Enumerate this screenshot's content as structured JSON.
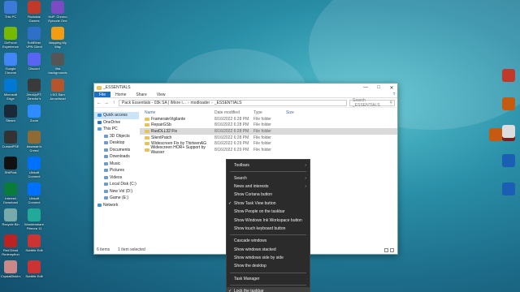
{
  "desktop": {
    "left_icons": [
      [
        "This PC",
        "Rockstar Games Launcher",
        "HoP: Chrono Episode One"
      ],
      [
        "GeForce Experience",
        "SoftEther VPN Client Manager",
        "Mapping My Way Remastered"
      ],
      [
        "Google Chrome",
        "Discord",
        "Vita backgrounds"
      ],
      [
        "Microsoft Edge",
        "ZeroUpPT: Director's Cut",
        "LSG Sam Arrowhead"
      ],
      [
        "Steam",
        "Zoom",
        ""
      ],
      [
        "CursedPSE",
        "Assassin's Creed Origins",
        ""
      ],
      [
        "ShitPost",
        "Ubisoft Connect",
        ""
      ],
      [
        "Internet Download Manager",
        "Ubisoft Connect",
        ""
      ],
      [
        "Recycle Bin",
        "Wondershare Filmora 11",
        ""
      ],
      [
        "Red Dead Redemption 2",
        "Subtitle Edit",
        ""
      ],
      [
        "CrystalDiskInfo",
        "Subtitle Edit",
        ""
      ]
    ]
  },
  "window": {
    "title": "_ESSENTIALS",
    "ribbon_tabs": [
      "File",
      "Home",
      "Share",
      "View"
    ],
    "help": "?",
    "address": [
      "Pack Essentials - 03k SA | iMore i...",
      "modloader",
      "_ESSENTIALS"
    ],
    "search_placeholder": "Search _ESSENTIALS",
    "nav": {
      "quick_access": "Quick access",
      "onedrive": "OneDrive",
      "this_pc": "This PC",
      "sub": [
        "3D Objects",
        "Desktop",
        "Documents",
        "Downloads",
        "Music",
        "Pictures",
        "Videos",
        "Local Disk (C:)",
        "New Vol (D:)",
        "Game (E:)"
      ],
      "network": "Network"
    },
    "columns": {
      "name": "Name",
      "date": "Date modified",
      "type": "Type",
      "size": "Size"
    },
    "rows": [
      {
        "name": "FramerateVigilante",
        "date": "8/16/2022 6:28 PM",
        "type": "File folder"
      },
      {
        "name": "RepairGSb",
        "date": "8/16/2022 6:28 PM",
        "type": "File folder"
      },
      {
        "name": "RuoDLL32 Fix",
        "date": "8/16/2022 6:28 PM",
        "type": "File folder"
      },
      {
        "name": "SilentPatch",
        "date": "8/16/2022 6:28 PM",
        "type": "File folder"
      },
      {
        "name": "Widescreen Fix by ThirteenAG",
        "date": "8/16/2022 6:29 PM",
        "type": "File folder"
      },
      {
        "name": "Widescreen HOR+ Support by Wasser",
        "date": "8/16/2022 6:29 PM",
        "type": "File folder"
      }
    ],
    "status": {
      "items": "6 items",
      "selected": "1 item selected"
    }
  },
  "context_menu": {
    "items": [
      {
        "label": "Toolbars",
        "arrow": true
      },
      {
        "sep": true
      },
      {
        "label": "Search",
        "arrow": true
      },
      {
        "label": "News and interests",
        "arrow": true
      },
      {
        "label": "Show Cortana button"
      },
      {
        "label": "Show Task View button",
        "check": true
      },
      {
        "label": "Show People on the taskbar"
      },
      {
        "label": "Show Windows Ink Workspace button"
      },
      {
        "label": "Show touch keyboard button"
      },
      {
        "sep": true
      },
      {
        "label": "Cascade windows"
      },
      {
        "label": "Show windows stacked"
      },
      {
        "label": "Show windows side by side"
      },
      {
        "label": "Show the desktop"
      },
      {
        "sep": true
      },
      {
        "label": "Task Manager"
      },
      {
        "sep": true
      },
      {
        "label": "Lock the taskbar",
        "check": true,
        "hover": true
      }
    ]
  },
  "right_icons": [
    "",
    "",
    "",
    "",
    "",
    "",
    ""
  ],
  "colors": {
    "accent": "#1a6fc4",
    "folder": "#e8c15a",
    "menu_bg": "#2b2b2b"
  }
}
